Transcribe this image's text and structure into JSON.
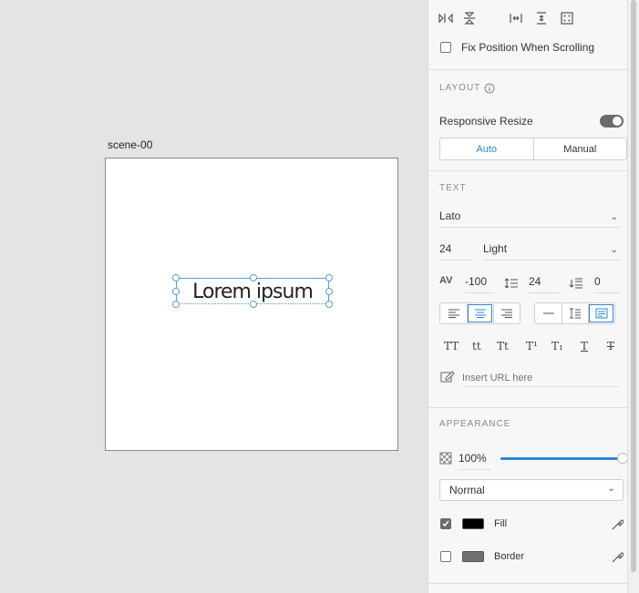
{
  "canvas": {
    "artboard_name": "scene-00",
    "text_content": "Lorem ipsum"
  },
  "panel": {
    "fix_position": {
      "label": "Fix Position When Scrolling",
      "checked": false
    },
    "layout": {
      "title": "LAYOUT",
      "responsive_resize_label": "Responsive Resize",
      "responsive_resize_on": true,
      "modes": [
        "Auto",
        "Manual"
      ],
      "selected_mode": "Auto"
    },
    "text": {
      "title": "TEXT",
      "font_family": "Lato",
      "font_size": "24",
      "font_weight": "Light",
      "character_spacing": "-100",
      "line_spacing": "24",
      "paragraph_spacing": "0",
      "align_selected": "center",
      "typographic_styles": [
        "TT",
        "tt",
        "Tt",
        "T¹",
        "T₁",
        "T",
        "T"
      ],
      "url_placeholder": "Insert URL here"
    },
    "appearance": {
      "title": "APPEARANCE",
      "opacity": "100%",
      "opacity_value": 1.0,
      "blend_mode": "Normal",
      "fill": {
        "label": "Fill",
        "checked": true,
        "color": "#000000"
      },
      "border": {
        "label": "Border",
        "checked": false,
        "color": "#707070"
      }
    }
  },
  "colors": {
    "accent": "#2f86d6"
  }
}
